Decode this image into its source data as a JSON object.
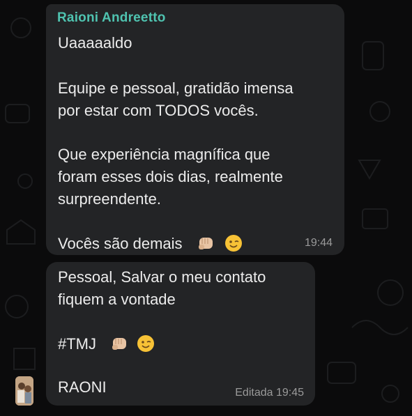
{
  "chat": {
    "message1": {
      "sender": "Raioni Andreetto",
      "lines": [
        "Uaaaaaldo",
        "Equipe e pessoal, gratidão imensa",
        "por estar com TODOS vocês.",
        "Que experiência magnífica que",
        "foram esses dois dias, realmente",
        "surpreendente.",
        "Vocês são demais"
      ],
      "emojis": [
        "fist-bump-emoji",
        "winking-face-emoji"
      ],
      "time": "19:44"
    },
    "message2": {
      "lines": [
        "Pessoal,  Salvar o meu contato",
        "fiquem a vontade",
        "#TMJ",
        "RAONI"
      ],
      "emojis": [
        "fist-bump-emoji",
        "winking-face-emoji"
      ],
      "edited_time": "Editada 19:45"
    }
  },
  "colors": {
    "background": "#0b0b0c",
    "bubble": "#232426",
    "sender_name": "#4fc3b0",
    "text": "#ececec",
    "meta": "#9a9a9a"
  }
}
